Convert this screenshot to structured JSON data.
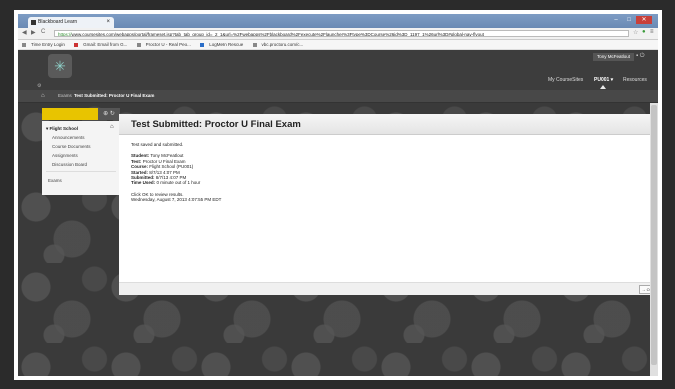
{
  "browser": {
    "tab_title": "Blackboard Learn",
    "tab_close": "×",
    "window_min": "–",
    "window_max": "□",
    "window_close": "✕",
    "back": "◀",
    "forward": "▶",
    "reload": "C",
    "url_secure": "https://",
    "url_rest": "www.coursesites.com/webapps/portal/frameset.jsp?tab_tab_group_id=_2_1&url=%2Fwebapps%2Fblackboard%2Fexecute%2Flauncher%3Ftype%3DCourse%26id%3D_1197_1%26url%3D#global-nav-flyout",
    "bookmarks": [
      "Time Entry Login",
      "Gmail: Email from G...",
      "Proctor U - Real Peo...",
      "LogMeIn Rescue",
      "vbc.proctoru.com/c..."
    ]
  },
  "header": {
    "user_name": "Tony McFeatlout",
    "nav": [
      "My CourseSites",
      "PU001",
      "Resources"
    ]
  },
  "breadcrumb": {
    "home": "⌂",
    "items": [
      "Exams",
      "Test Submitted: Proctor U Final Exam"
    ]
  },
  "sidebar": {
    "course": "Flight School",
    "items": [
      "Announcements",
      "Course Documents",
      "Assignments",
      "Discussion Board",
      "Exams"
    ]
  },
  "panel": {
    "title": "Test Submitted: Proctor U Final Exam",
    "saved_msg": "Test saved and submitted.",
    "student_label": "Student:",
    "student": "Tony McFeatlout",
    "test_label": "Test:",
    "test": "Proctor U Final Exam",
    "course_label": "Course:",
    "course": "Flight School (PU001)",
    "started_label": "Started:",
    "started": "8/7/13 4:07 PM",
    "submitted_label": "Submitted:",
    "submitted": "8/7/13 4:07 PM",
    "time_label": "Time Used:",
    "time_used": "0 minute out of 1 hour",
    "click_text": "Click OK to review results.",
    "date_text": "Wednesday, August 7, 2013 4:07:55 PM EDT",
    "ok_label": "OK"
  }
}
